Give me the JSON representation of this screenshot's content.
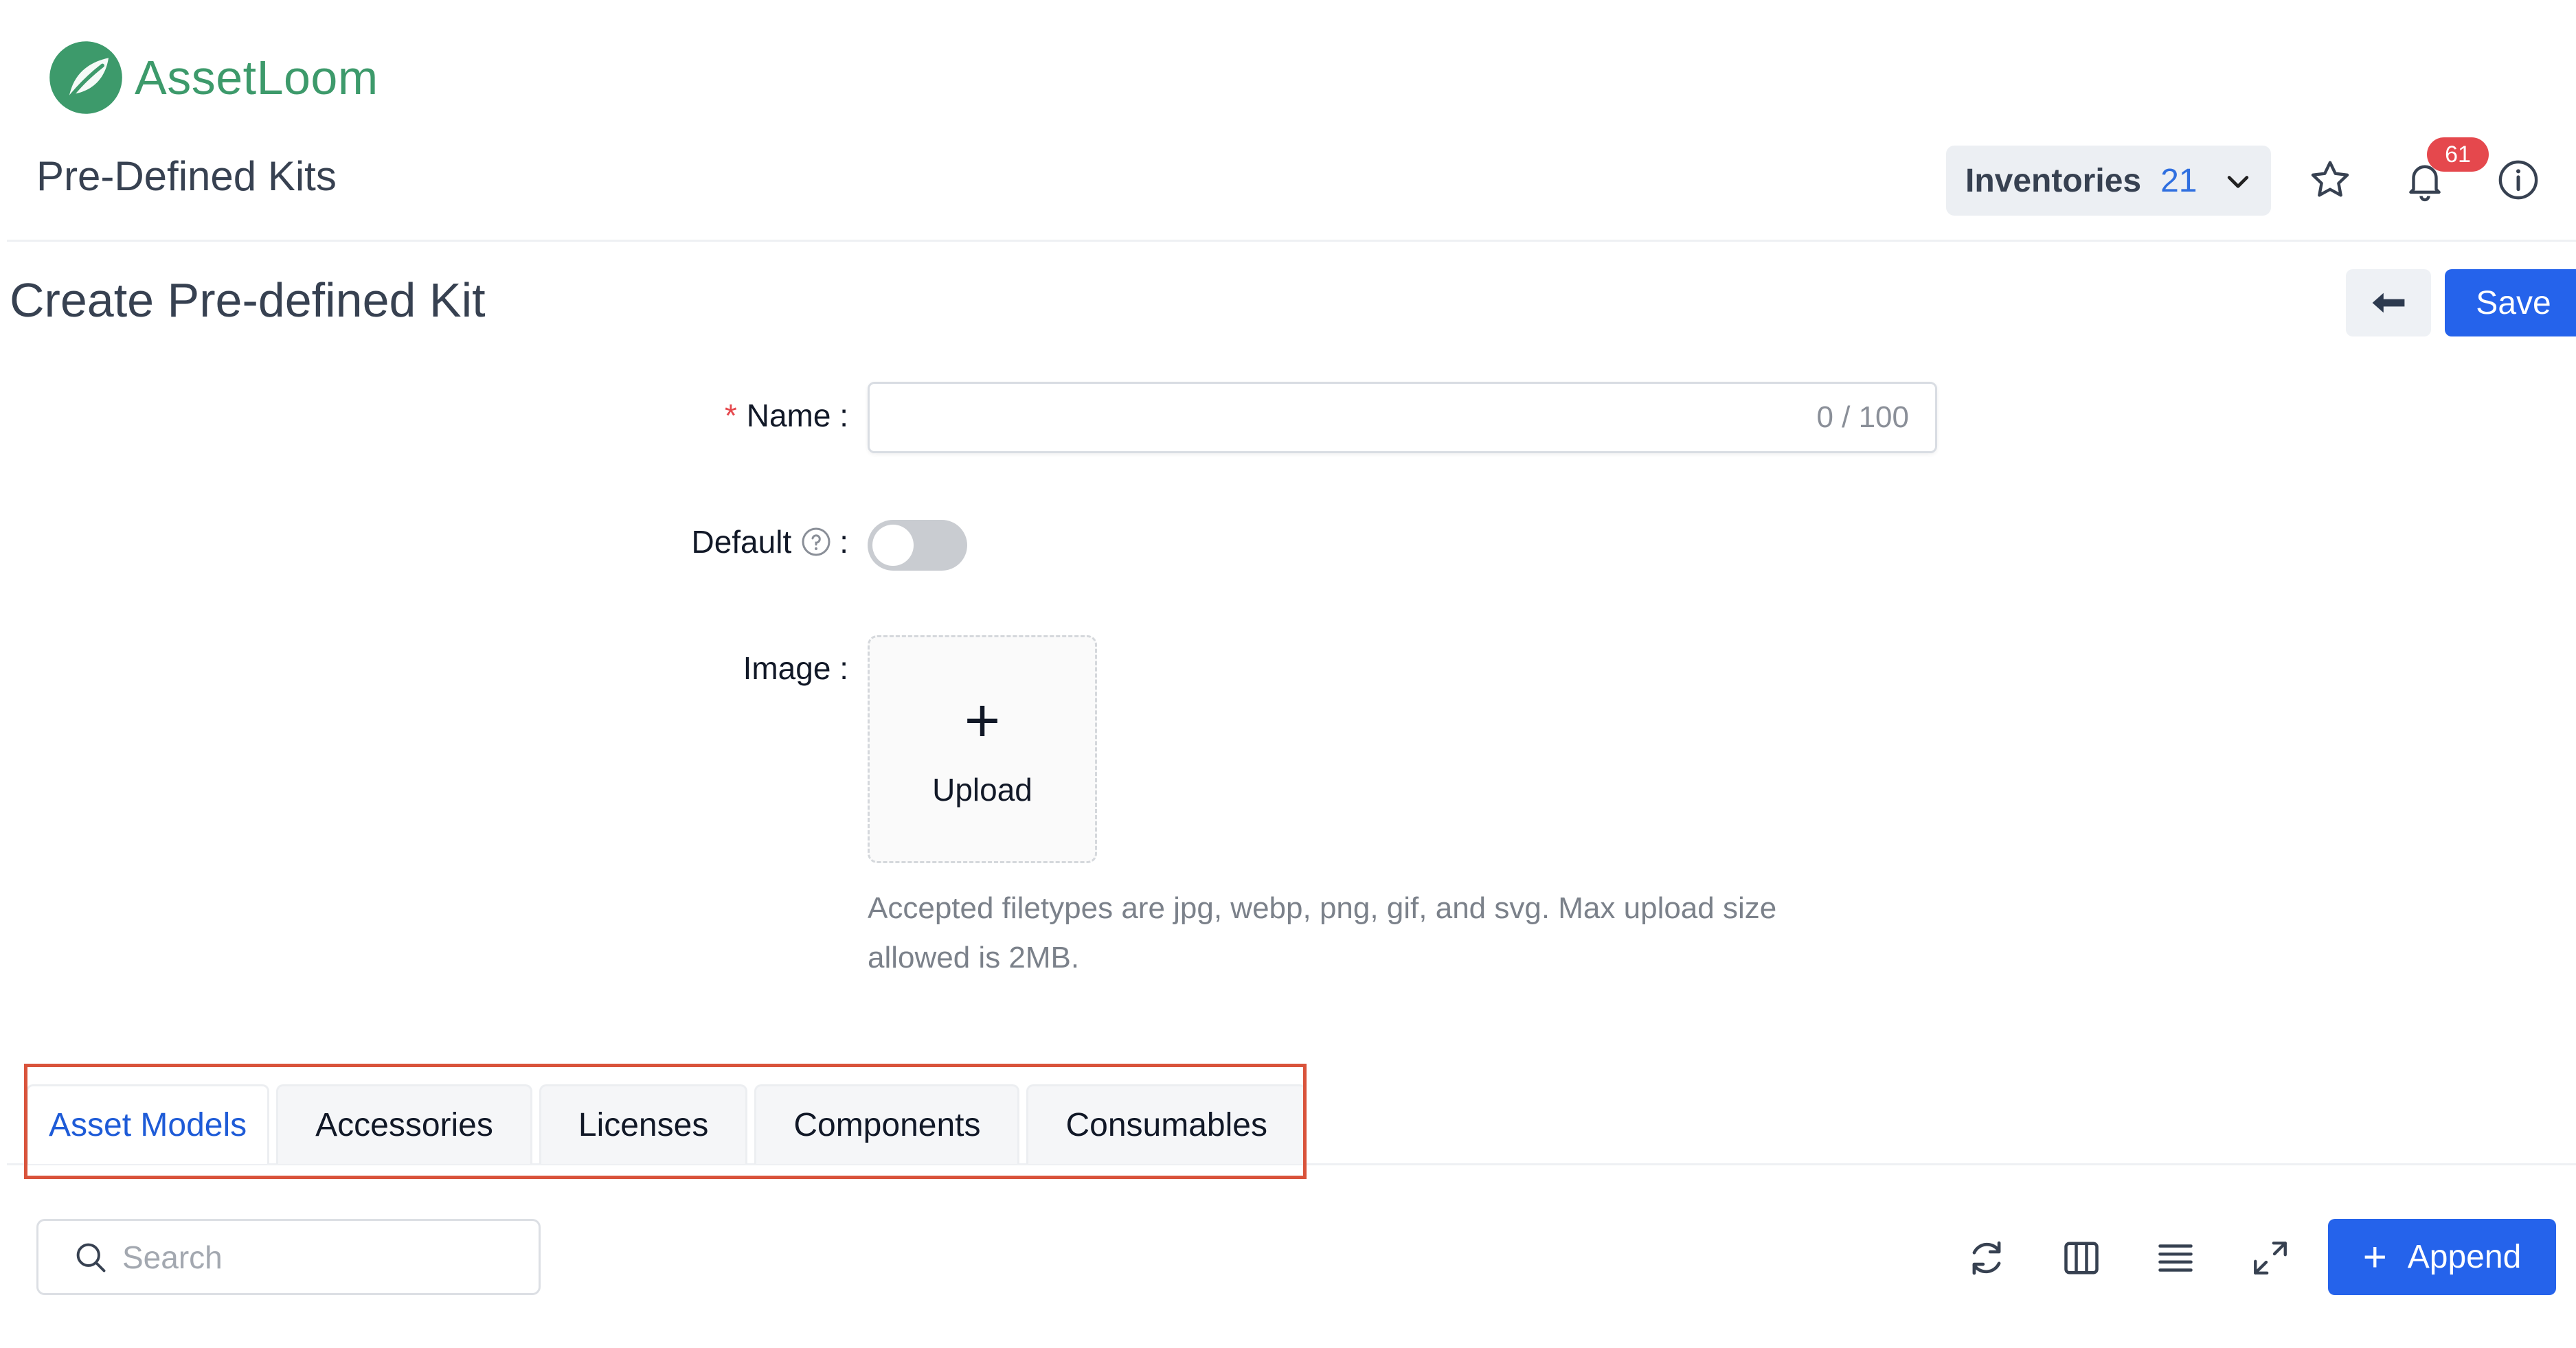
{
  "app": {
    "name": "AssetLoom"
  },
  "header": {
    "page_title": "Pre-Defined Kits",
    "inventory_label": "Inventories",
    "inventory_count": "21",
    "notification_count": "61"
  },
  "form": {
    "title": "Create Pre-defined Kit",
    "save_label": "Save",
    "name_label": "Name",
    "name_value": "",
    "name_counter": "0 / 100",
    "default_label": "Default",
    "default_on": false,
    "image_label": "Image",
    "upload_plus": "+",
    "upload_label": "Upload",
    "upload_hint": "Accepted filetypes are jpg, webp, png, gif, and svg. Max upload size allowed is 2MB."
  },
  "tabs": [
    {
      "label": "Asset Models",
      "active": true
    },
    {
      "label": "Accessories",
      "active": false
    },
    {
      "label": "Licenses",
      "active": false
    },
    {
      "label": "Components",
      "active": false
    },
    {
      "label": "Consumables",
      "active": false
    }
  ],
  "toolbar": {
    "search_placeholder": "Search",
    "append_label": "Append",
    "append_plus": "+"
  },
  "colors": {
    "brand": "#3d9a6b",
    "primary": "#2563eb",
    "badge": "#e5484d",
    "tab_active": "#1e5bd7",
    "highlight": "#d9533b"
  },
  "icons": [
    "leaf-logo-icon",
    "chevron-down-icon",
    "star-icon",
    "bell-icon",
    "info-icon",
    "arrow-left-icon",
    "help-circle-icon",
    "search-icon",
    "reload-icon",
    "columns-icon",
    "density-icon",
    "fullscreen-icon",
    "plus-icon"
  ]
}
